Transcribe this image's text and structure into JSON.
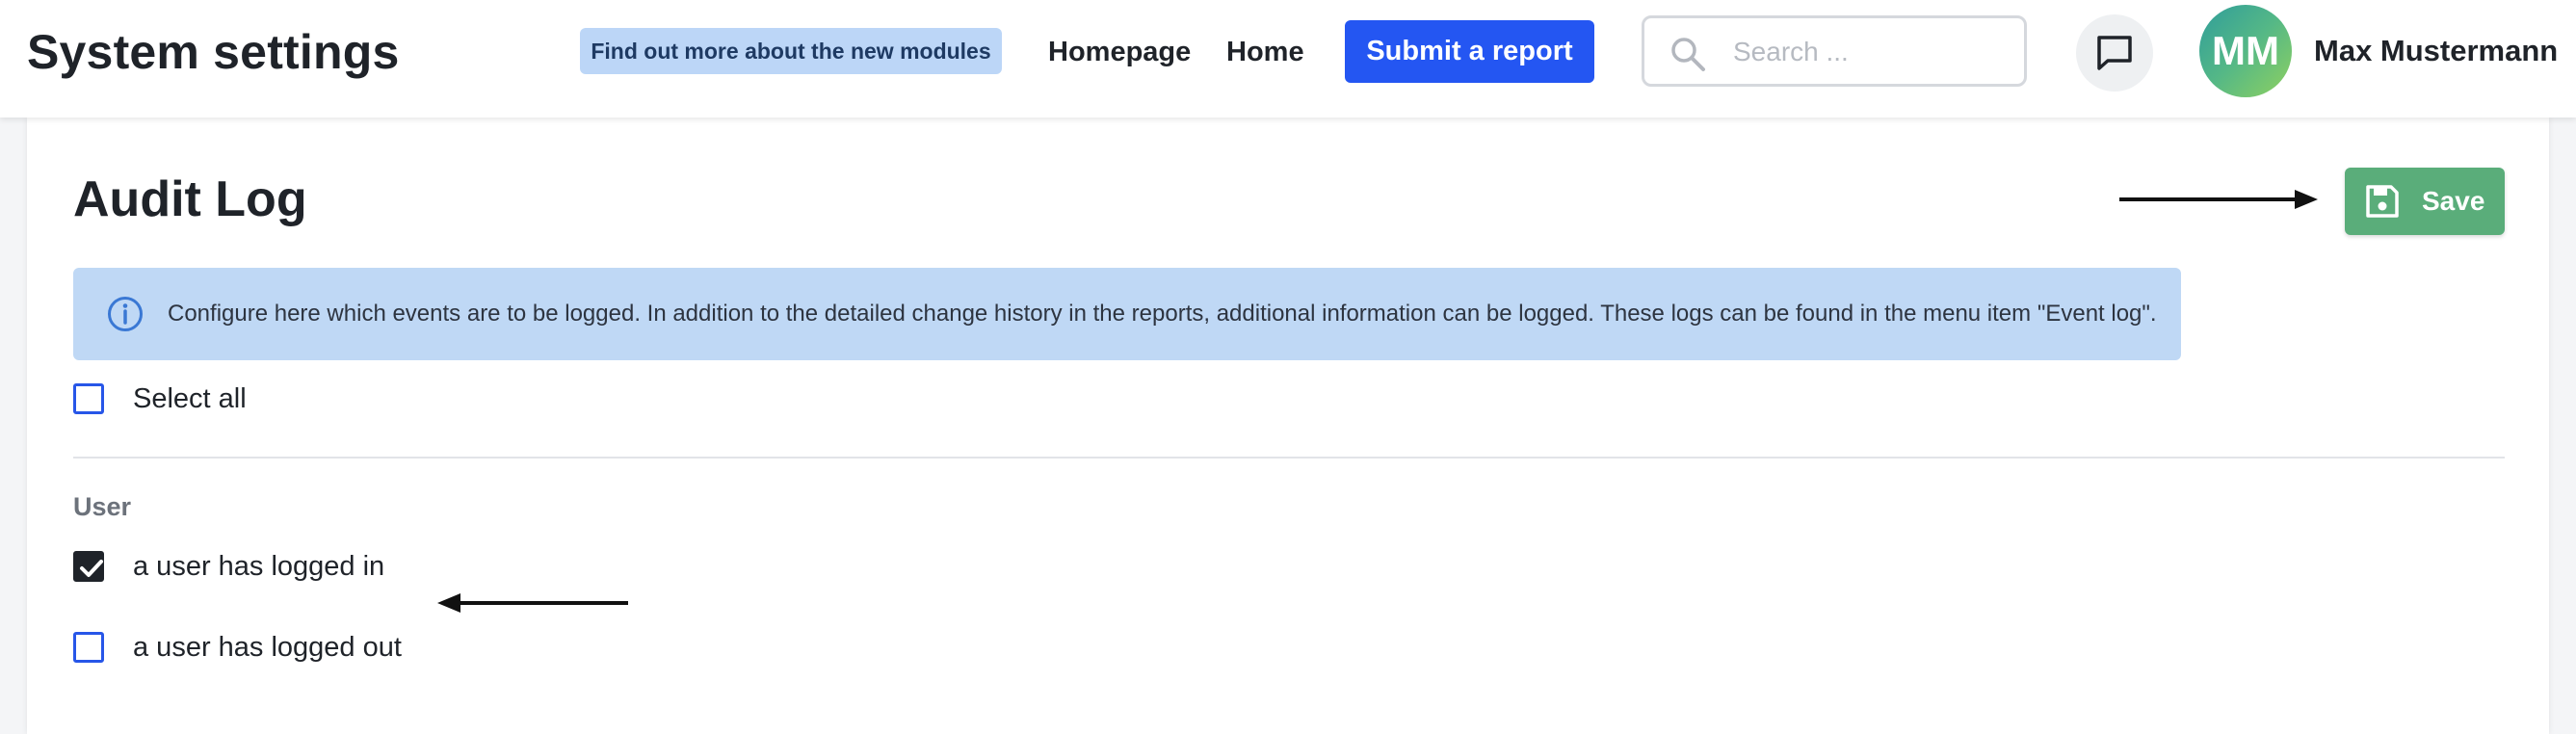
{
  "header": {
    "app_title": "System settings",
    "news_pill": "Find out more about the new modules",
    "nav": [
      {
        "label": "Homepage"
      },
      {
        "label": "Home"
      }
    ],
    "submit_button": "Submit a report",
    "search_placeholder": "Search ...",
    "chat_icon": "chat-bubble-icon",
    "user": {
      "initials": "MM",
      "name": "Max Mustermann"
    }
  },
  "main": {
    "title": "Audit Log",
    "save_button": "Save",
    "info": "Configure here which events are to be logged. In addition to the detailed change history in the reports, additional information can be logged. These logs can be found in the menu item \"Event log\".",
    "select_all": {
      "label": "Select all",
      "checked": false
    },
    "sections": [
      {
        "label": "User",
        "items": [
          {
            "label": "a user has logged in",
            "checked": true
          },
          {
            "label": "a user has logged out",
            "checked": false
          }
        ]
      }
    ]
  },
  "colors": {
    "primary": "#2456f2",
    "save_green": "#5aad7a",
    "info_bg": "#bfd8f5",
    "pill_bg": "#bcd6f7",
    "checkbox_border": "#2756e8"
  }
}
